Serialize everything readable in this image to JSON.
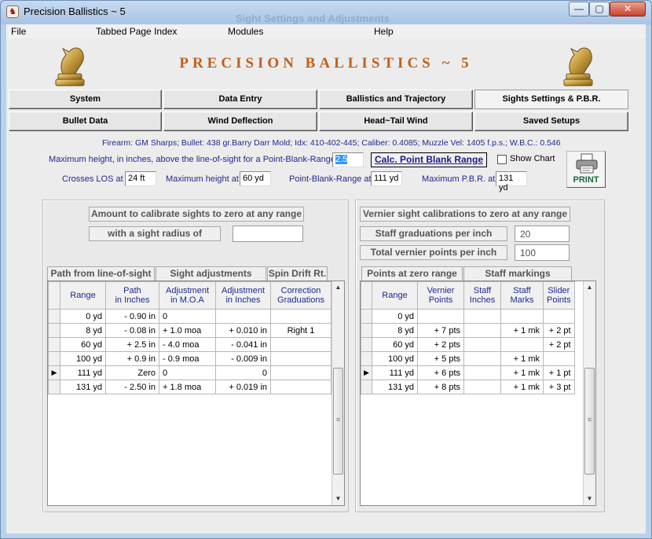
{
  "window": {
    "title": "Precision Ballistics ~ 5",
    "ghost_title": "Sight Settings and Adjustments",
    "minimize": "—",
    "maximize": "▢",
    "close": "✕"
  },
  "menu": [
    "File",
    "Tabbed Page Index",
    "Modules",
    "Help"
  ],
  "banner": {
    "title": "PRECISION BALLISTICS ~ 5"
  },
  "tabs_row1": [
    "System",
    "Data Entry",
    "Ballistics and Trajectory",
    "Sights Settings & P.B.R."
  ],
  "tabs_row2": [
    "Bullet Data",
    "Wind Deflection",
    "Head~Tail Wind",
    "Saved Setups"
  ],
  "info_line": "Firearm: GM Sharps;   Bullet: 438 gr.Barry Darr Mold;   Idx: 410-402-445;   Caliber: 0.4085;   Muzzle Vel: 1405 f.p.s.;   W.B.C.: 0.546",
  "pbr": {
    "max_height_label": "Maximum height, in inches, above the line-of-sight for a Point-Blank-Range",
    "max_height_value": "2.5",
    "calc_button": "Calc. Point Blank Range",
    "show_chart_label": "Show Chart",
    "print_label": "PRINT",
    "crosses_los_label": "Crosses LOS at",
    "crosses_los_value": "24 ft",
    "max_height_at_label": "Maximum height at",
    "max_height_at_value": "60 yd",
    "pbr_at_label": "Point-Blank-Range at",
    "pbr_at_value": "111 yd",
    "max_pbr_label": "Maximum P.B.R. at",
    "max_pbr_value": "131 yd"
  },
  "left_panel": {
    "calibrate_caption": "Amount to calibrate  sights to zero at any range",
    "radius_caption": "with  a sight radius of",
    "radius_value": "",
    "path_caption": "Path from line-of-sight",
    "adjust_caption": "Sight adjustments",
    "spin_caption": "Spin Drift Rt.",
    "headers": [
      "Range",
      "Path\nin Inches",
      "Adjustment\nin M.O.A",
      "Adjustment\nin Inches",
      "Correction\nGraduations"
    ],
    "rows": [
      {
        "marker": "",
        "cells": [
          "0 yd",
          "- 0.90 in",
          "0",
          "",
          ""
        ]
      },
      {
        "marker": "",
        "cells": [
          "8 yd",
          "- 0.08 in",
          "+ 1.0  moa",
          "+ 0.010 in",
          "Right  1"
        ]
      },
      {
        "marker": "",
        "cells": [
          "60 yd",
          "+ 2.5 in",
          "- 4.0  moa",
          "- 0.041 in",
          ""
        ]
      },
      {
        "marker": "",
        "cells": [
          "100 yd",
          "+ 0.9 in",
          "- 0.9  moa",
          "- 0.009 in",
          ""
        ]
      },
      {
        "marker": "▶",
        "cells": [
          "111 yd",
          "Zero",
          "0",
          "0",
          ""
        ]
      },
      {
        "marker": "",
        "cells": [
          "131 yd",
          "- 2.50 in",
          "+ 1.8  moa",
          "+ 0.019 in",
          ""
        ]
      }
    ]
  },
  "right_panel": {
    "vernier_caption": "Vernier sight  calibrations to zero at any range",
    "staff_grad_caption": "Staff graduations per inch",
    "staff_grad_value": "20",
    "vernier_points_caption": "Total  vernier points  per inch",
    "vernier_points_value": "100",
    "zero_caption": "Points at zero range",
    "markings_caption": "Staff  markings",
    "headers": [
      "Range",
      "Vernier\nPoints",
      "Staff\nInches",
      "Staff\nMarks",
      "Slider\nPoints"
    ],
    "rows": [
      {
        "marker": "",
        "cells": [
          "0 yd",
          "",
          "",
          "",
          ""
        ]
      },
      {
        "marker": "",
        "cells": [
          "8 yd",
          "+ 7  pts",
          "",
          "+ 1 mk",
          "+ 2 pt"
        ]
      },
      {
        "marker": "",
        "cells": [
          "60 yd",
          "+ 2  pts",
          "",
          "",
          "+ 2 pt"
        ]
      },
      {
        "marker": "",
        "cells": [
          "100 yd",
          "+ 5  pts",
          "",
          "+ 1 mk",
          ""
        ]
      },
      {
        "marker": "▶",
        "cells": [
          "111 yd",
          "+ 6  pts",
          "",
          "+ 1 mk",
          "+ 1 pt"
        ]
      },
      {
        "marker": "",
        "cells": [
          "131 yd",
          "+ 8  pts",
          "",
          "+ 1 mk",
          "+ 3 pt"
        ]
      }
    ]
  },
  "colors": {
    "accent": "#c0601c",
    "label_blue": "#1e2a8e"
  }
}
